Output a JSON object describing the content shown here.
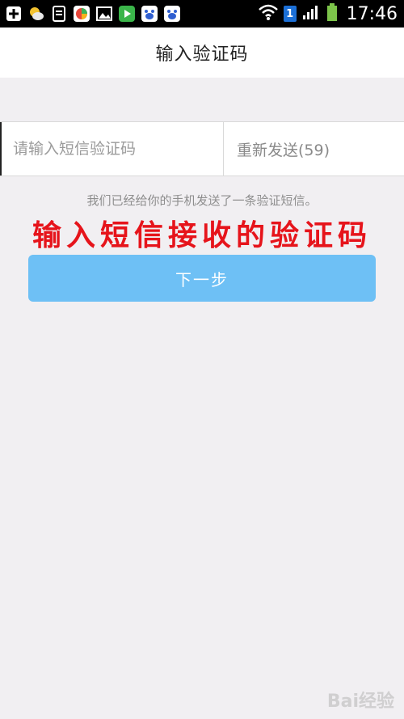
{
  "status_bar": {
    "time": "17:46",
    "sim_number": "1",
    "icons": [
      "plus-icon",
      "weather-icon",
      "document-icon",
      "app-store-icon",
      "gallery-icon",
      "video-icon",
      "baidu-icon",
      "baidu-icon",
      "wifi-icon",
      "signal-icon",
      "battery-icon"
    ]
  },
  "header": {
    "title": "输入验证码"
  },
  "form": {
    "code_placeholder": "请输入短信验证码",
    "resend_label": "重新发送(59)",
    "info_text": "我们已经给你的手机发送了一条验证短信。",
    "next_label": "下一步"
  },
  "annotation": {
    "text": "输入短信接收的验证码",
    "color": "#e6141b"
  },
  "watermark": {
    "text": "Bai经验"
  },
  "colors": {
    "background": "#f1eff2",
    "button": "#6ec0f5",
    "annotation": "#e6141b"
  }
}
